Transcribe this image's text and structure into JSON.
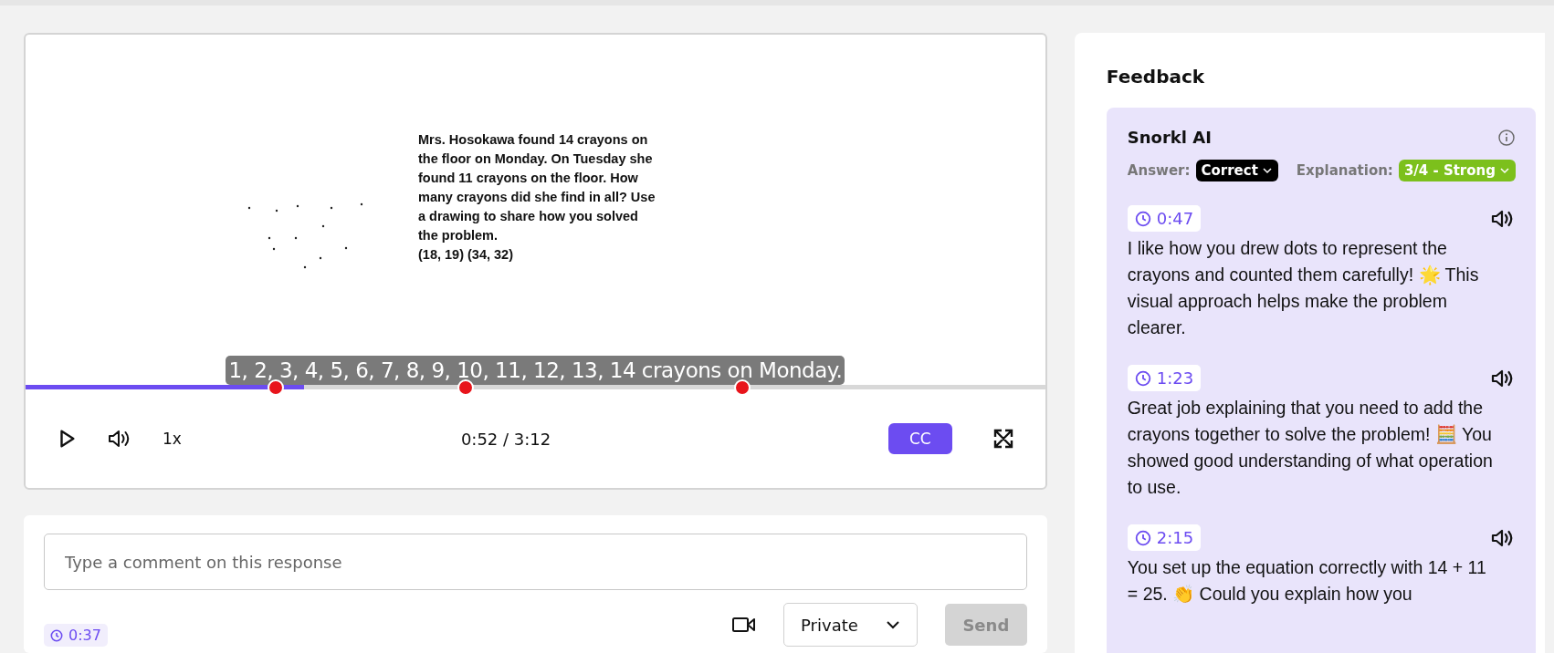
{
  "video": {
    "problem_text": "Mrs. Hosokawa found 14 crayons on the floor on Monday. On Tuesday she found 11 crayons on the floor. How many crayons did she find in all? Use a drawing to share how you solved the problem.",
    "coordinates": "(18, 19) (34, 32)",
    "caption": "1, 2, 3, 4, 5, 6, 7, 8, 9, 10, 11, 12, 13, 14 crayons on Monday.",
    "progress": {
      "level": 0.273
    },
    "markers": [
      {
        "level": 0.245
      },
      {
        "level": 0.432
      },
      {
        "level": 0.703
      }
    ],
    "playing": false,
    "speed": "1x",
    "time": "0:52 / 3:12",
    "cc": {
      "label": "CC",
      "on": true
    }
  },
  "comment": {
    "placeholder": "Type a comment on this response",
    "timestamp": "0:37",
    "visibility": "Private",
    "send": {
      "label": "Send",
      "disabled": true
    }
  },
  "feedback": {
    "title": "Feedback",
    "source": "Snorkl AI",
    "answer_label": "Answer:",
    "answer": "Correct",
    "explanation_label": "Explanation:",
    "explanation": "3/4 - Strong",
    "items": [
      {
        "time": "0:47",
        "text": "I like how you drew dots to represent the crayons and counted them carefully! 🌟 This visual approach helps make the problem clearer."
      },
      {
        "time": "1:23",
        "text": "Great job explaining that you need to add the crayons together to solve the problem! 🧮 You showed good understanding of what operation to use."
      },
      {
        "time": "2:15",
        "text": "You set up the equation correctly with 14 + 11 = 25. 👏 Could you explain how you"
      }
    ]
  }
}
